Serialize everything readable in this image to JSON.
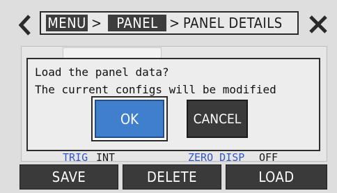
{
  "header": {
    "breadcrumb": {
      "menu": "MENU",
      "sep1": ">",
      "panel": "PANEL",
      "sep2": ">",
      "details": "PANEL DETAILS"
    },
    "back_icon": "chevron-left-icon",
    "close_icon": "close-icon"
  },
  "background": {
    "trig_label": "TRIG",
    "trig_value": "INT",
    "zero_label": "ZERO DISP",
    "zero_value": "OFF"
  },
  "dialog": {
    "line1": "Load the panel data?",
    "line2": "The current configs will be modified",
    "ok_label": "OK",
    "cancel_label": "CANCEL"
  },
  "toolbar": {
    "save_label": "SAVE",
    "delete_label": "DELETE",
    "load_label": "LOAD"
  },
  "colors": {
    "accent_blue": "#3f7fcc",
    "label_blue": "#2e57c8",
    "dark_button": "#3a3a3a"
  }
}
